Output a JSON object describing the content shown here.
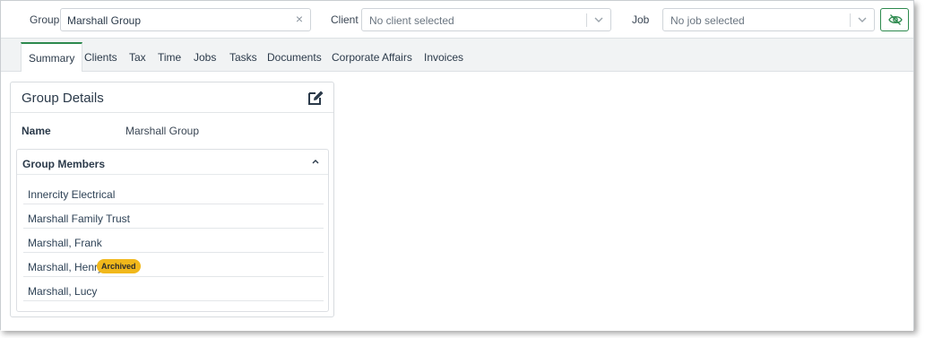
{
  "filters": {
    "group_label": "Group",
    "group_value": "Marshall Group",
    "client_label": "Client",
    "client_placeholder": "No client selected",
    "job_label": "Job",
    "job_placeholder": "No job selected",
    "clear_glyph": "×",
    "toggle_icon": "eye-off-icon"
  },
  "tabs": [
    {
      "label": "Summary",
      "active": true
    },
    {
      "label": "Clients"
    },
    {
      "label": "Tax"
    },
    {
      "label": "Time"
    },
    {
      "label": "Jobs"
    },
    {
      "label": "Tasks"
    },
    {
      "label": "Documents"
    },
    {
      "label": "Corporate Affairs"
    },
    {
      "label": "Invoices"
    }
  ],
  "group_details": {
    "title": "Group Details",
    "edit_icon": "edit-icon",
    "name_label": "Name",
    "name_value": "Marshall Group",
    "members_title": "Group Members",
    "members": [
      {
        "name": "Innercity Electrical"
      },
      {
        "name": "Marshall Family Trust"
      },
      {
        "name": "Marshall, Frank"
      },
      {
        "name": "Marshall, Henry",
        "badge": "Archived"
      },
      {
        "name": "Marshall, Lucy"
      }
    ]
  },
  "colors": {
    "accent": "#2d8a4e",
    "badge": "#f1b81b",
    "background": "#f1f3f4"
  }
}
